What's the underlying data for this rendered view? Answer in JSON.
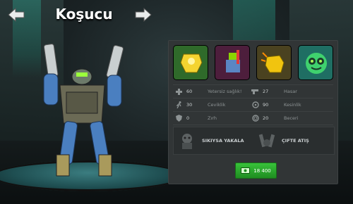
{
  "header": {
    "title": "Koşucu",
    "prev_arrow_icon": "arrow-left-icon",
    "next_arrow_icon": "arrow-right-icon"
  },
  "skills": [
    {
      "name": "gold-armor-icon"
    },
    {
      "name": "red-robot-icon"
    },
    {
      "name": "gold-fist-icon"
    },
    {
      "name": "green-face-icon"
    }
  ],
  "stats": [
    {
      "left": {
        "icon": "health-cross-icon",
        "value": "60",
        "label": "Yetersiz sağlık!"
      },
      "right": {
        "icon": "gun-icon",
        "value": "27",
        "label": "Hasar"
      }
    },
    {
      "left": {
        "icon": "running-figure-icon",
        "value": "30",
        "label": "Ceviklik"
      },
      "right": {
        "icon": "crosshair-icon",
        "value": "90",
        "label": "Kesinlik"
      }
    },
    {
      "left": {
        "icon": "shield-icon",
        "value": "0",
        "label": "Zırh"
      },
      "right": {
        "icon": "target-icon",
        "value": "20",
        "label": "Beceri"
      }
    }
  ],
  "abilities": [
    {
      "label": "SIKIYSA YAKALA",
      "icon": "grab-ability-icon"
    },
    {
      "label": "ÇIFTE ATIŞ",
      "icon": "double-shot-icon"
    }
  ],
  "buy": {
    "price": "18 400",
    "icon": "money-icon"
  },
  "colors": {
    "accent_green": "#2fb02f",
    "panel": "#313536",
    "gold": "#f1c40f"
  }
}
